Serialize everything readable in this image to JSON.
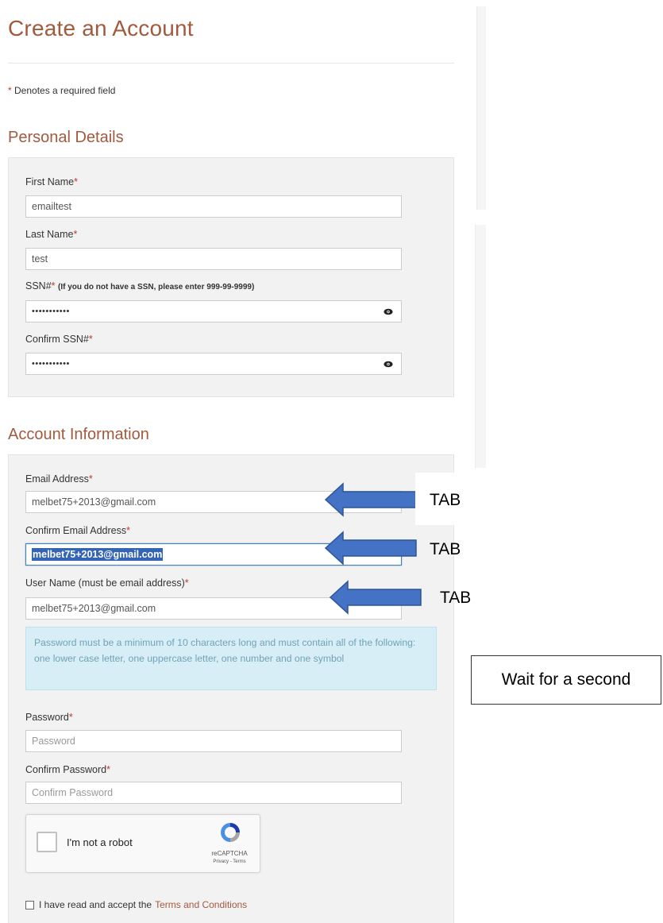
{
  "header": {
    "title": "Create an Account",
    "required_marker": "*",
    "required_note": "Denotes a required field"
  },
  "personal": {
    "title": "Personal Details",
    "first_name_label": "First Name",
    "first_name_value": "emailtest",
    "last_name_label": "Last Name",
    "last_name_value": "test",
    "ssn_label": "SSN#",
    "ssn_hint": "(If you do not have a SSN, please enter 999-99-9999)",
    "ssn_value": "•••••••••••",
    "confirm_ssn_label": "Confirm SSN#",
    "confirm_ssn_value": "•••••••••••"
  },
  "account": {
    "title": "Account Information",
    "email_label": "Email Address",
    "email_value": "melbet75+2013@gmail.com",
    "confirm_email_label": "Confirm Email Address",
    "confirm_email_value": "melbet75+2013@gmail.com",
    "username_label": "User Name (must be email address)",
    "username_value": "melbet75+2013@gmail.com",
    "password_rules": "Password must be a minimum of 10 characters long and must contain all of the following: one lower case letter, one uppercase letter, one number and one symbol",
    "password_label": "Password",
    "password_placeholder": "Password",
    "confirm_password_label": "Confirm Password",
    "confirm_password_placeholder": "Confirm Password"
  },
  "captcha": {
    "label": "I'm not a robot",
    "brand": "reCAPTCHA",
    "links": "Privacy - Terms"
  },
  "terms": {
    "prefix": "I have read and accept the",
    "link": "Terms and Conditions"
  },
  "annotations": {
    "tab_1": "TAB",
    "tab_2": "TAB",
    "tab_3": "TAB",
    "wait_note": "Wait for a second",
    "arrow_color": "#4472c4"
  },
  "colors": {
    "heading": "#a25a3f",
    "required": "#c0392b",
    "selection": "#3464b4",
    "info_bg": "#d8eef6"
  }
}
